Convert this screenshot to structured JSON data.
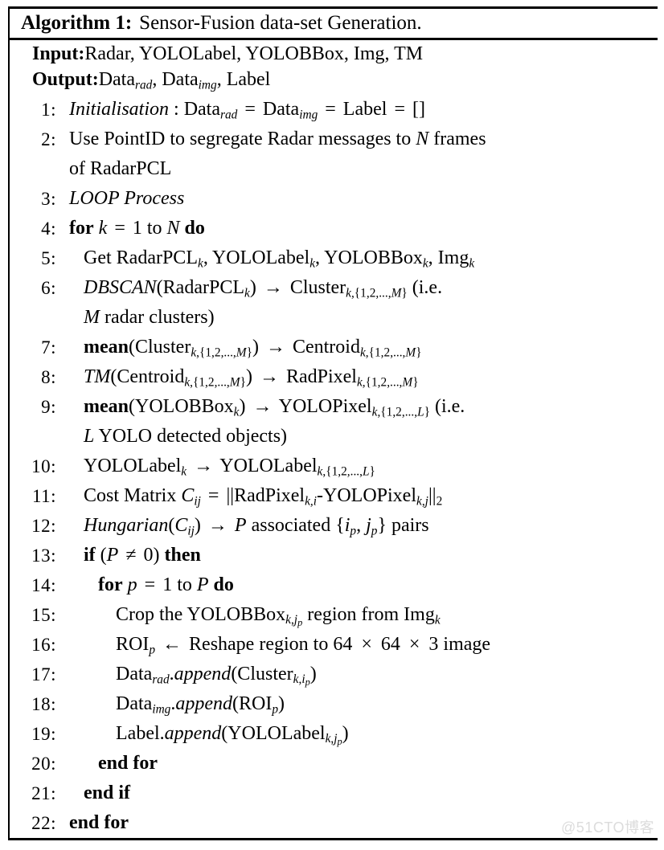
{
  "algorithm": {
    "label": "Algorithm 1:",
    "title": "Sensor-Fusion data-set Generation.",
    "io": {
      "input_key": "Input:",
      "input_value": "Radar, YOLOLabel, YOLOBBox, Img, TM",
      "output_key": "Output:",
      "output_value_prefix": "Data",
      "output_sub1": "rad",
      "output_mid": ", Data",
      "output_sub2": "img",
      "output_suffix": ", Label"
    },
    "watermark": "@51CTO博客",
    "line_numbers": [
      "1:",
      "2:",
      "3:",
      "4:",
      "5:",
      "6:",
      "7:",
      "8:",
      "9:",
      "10:",
      "11:",
      "12:",
      "13:",
      "14:",
      "15:",
      "16:",
      "17:",
      "18:",
      "19:",
      "20:",
      "21:",
      "22:"
    ],
    "steps": [
      {
        "n": "1:",
        "indent": 0,
        "text": "Initialisation : Data_rad = Data_img = Label = []"
      },
      {
        "n": "2:",
        "indent": 0,
        "text": "Use PointID to segregate Radar messages to N frames of RadarPCL"
      },
      {
        "n": "3:",
        "indent": 0,
        "text": "LOOP Process"
      },
      {
        "n": "4:",
        "indent": 0,
        "text": "for k = 1 to N do"
      },
      {
        "n": "5:",
        "indent": 1,
        "text": "Get RadarPCL_k, YOLOLabel_k, YOLOBBox_k, Img_k"
      },
      {
        "n": "6:",
        "indent": 1,
        "text": "DBSCAN(RadarPCL_k) → Cluster_{k,{1,2,...,M}} (i.e. M radar clusters)"
      },
      {
        "n": "7:",
        "indent": 1,
        "text": "mean(Cluster_{k,{1,2,...,M}}) → Centroid_{k,{1,2,...,M}}"
      },
      {
        "n": "8:",
        "indent": 1,
        "text": "TM(Centroid_{k,{1,2,...,M}}) → RadPixel_{k,{1,2,...,M}}"
      },
      {
        "n": "9:",
        "indent": 1,
        "text": "mean(YOLOBBox_k) → YOLOPixel_{k,{1,2,...,L}} (i.e. L YOLO detected objects)"
      },
      {
        "n": "10:",
        "indent": 1,
        "text": "YOLOLabel_k → YOLOLabel_{k,{1,2,...,L}}"
      },
      {
        "n": "11:",
        "indent": 1,
        "text": "Cost Matrix C_ij = ||RadPixel_{k,i}-YOLOPixel_{k,j}||_2"
      },
      {
        "n": "12:",
        "indent": 1,
        "text": "Hungarian(C_ij) → P associated {i_p, j_p} pairs"
      },
      {
        "n": "13:",
        "indent": 1,
        "text": "if (P ≠ 0) then"
      },
      {
        "n": "14:",
        "indent": 2,
        "text": "for p = 1 to P do"
      },
      {
        "n": "15:",
        "indent": 3,
        "text": "Crop the YOLOBBox_{k,j_p} region from Img_k"
      },
      {
        "n": "16:",
        "indent": 3,
        "text": "ROI_p ← Reshape region to 64 × 64 × 3 image"
      },
      {
        "n": "17:",
        "indent": 3,
        "text": "Data_rad.append(Cluster_{k,i_p})"
      },
      {
        "n": "18:",
        "indent": 3,
        "text": "Data_img.append(ROI_p)"
      },
      {
        "n": "19:",
        "indent": 3,
        "text": "Label.append(YOLOLabel_{k,j_p})"
      },
      {
        "n": "20:",
        "indent": 2,
        "text": "end for"
      },
      {
        "n": "21:",
        "indent": 1,
        "text": "end if"
      },
      {
        "n": "22:",
        "indent": 0,
        "text": "end for"
      }
    ]
  }
}
